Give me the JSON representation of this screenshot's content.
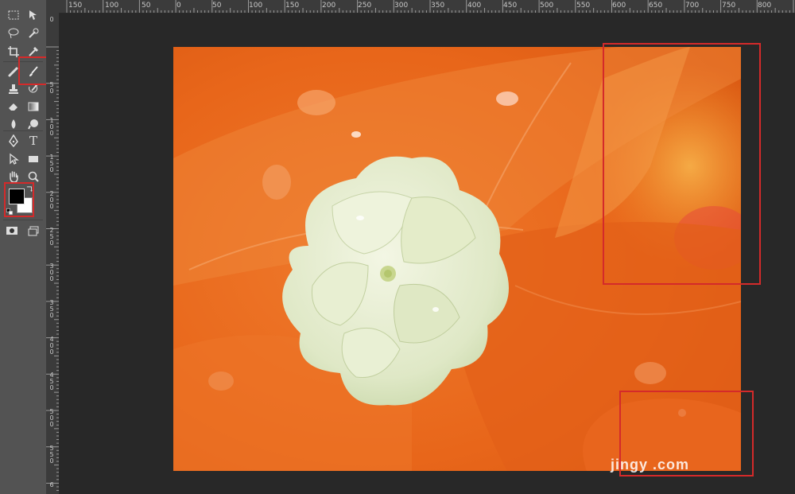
{
  "rulers": {
    "top_labels": [
      "150",
      "100",
      "50",
      "0",
      "50",
      "100",
      "150",
      "200",
      "250",
      "300",
      "350",
      "400",
      "450",
      "500",
      "550",
      "600",
      "650",
      "700",
      "750",
      "800"
    ],
    "left_labels": [
      "0",
      "5 0",
      "1 0 0",
      "1 5 0",
      "2 0 0",
      "2 5 0",
      "3 0 0",
      "3 5 0",
      "4 0 0",
      "4 5 0",
      "5 0 0",
      "5 5 0",
      "6"
    ]
  },
  "toolbar": {
    "tools": [
      {
        "name": "rectangular-marquee-icon"
      },
      {
        "name": "move-icon"
      },
      {
        "name": "lasso-icon"
      },
      {
        "name": "quick-selection-icon"
      },
      {
        "name": "crop-icon"
      },
      {
        "name": "eyedropper-icon"
      },
      {
        "name": "spot-healing-icon"
      },
      {
        "name": "brush-icon",
        "selected": true
      },
      {
        "name": "clone-stamp-icon"
      },
      {
        "name": "history-brush-icon"
      },
      {
        "name": "eraser-icon"
      },
      {
        "name": "gradient-icon"
      },
      {
        "name": "blur-icon"
      },
      {
        "name": "dodge-icon"
      },
      {
        "name": "pen-icon"
      },
      {
        "name": "type-icon",
        "glyph": "T"
      },
      {
        "name": "path-selection-icon"
      },
      {
        "name": "rectangle-shape-icon"
      },
      {
        "name": "hand-icon"
      },
      {
        "name": "zoom-icon"
      }
    ],
    "foreground_color": "#000000",
    "background_color": "#ffffff",
    "highlight_color": "#d42a2a"
  },
  "document": {
    "watermark": "jingy      .com",
    "colors": {
      "leaf": "#e8661a",
      "leaf_light": "#f58a3a",
      "flower": "#dfe8c6"
    }
  }
}
